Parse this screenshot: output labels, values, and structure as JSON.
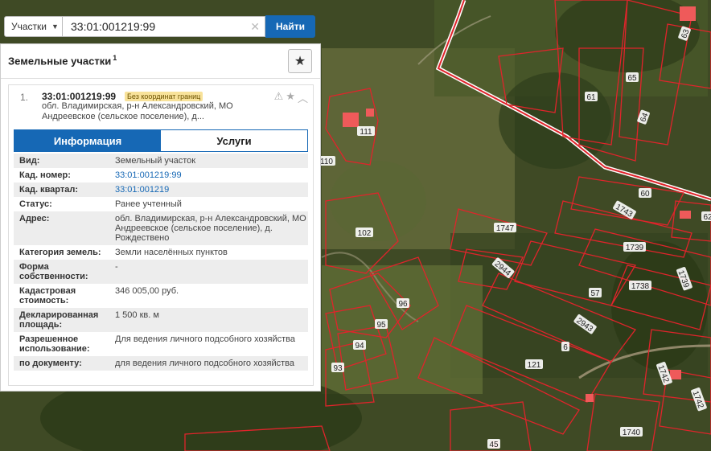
{
  "search": {
    "category": "Участки",
    "value": "33:01:001219:99",
    "find_label": "Найти"
  },
  "panel": {
    "title": "Земельные участки",
    "title_count": "1"
  },
  "result": {
    "index": "1.",
    "cad_number": "33:01:001219:99",
    "badge": "Без координат границ",
    "address": "обл. Владимирская, р-н Александровский, МО Андреевское (сельское поселение), д..."
  },
  "tabs": [
    {
      "label": "Информация"
    },
    {
      "label": "Услуги"
    }
  ],
  "info_rows": [
    {
      "key": "Вид:",
      "value": "Земельный участок"
    },
    {
      "key": "Кад. номер:",
      "value": "33:01:001219:99"
    },
    {
      "key": "Кад. квартал:",
      "value": "33:01:001219"
    },
    {
      "key": "Статус:",
      "value": "Ранее учтенный"
    },
    {
      "key": "Адрес:",
      "value": "обл. Владимирская, р-н Александровский, МО Андреевское (сельское поселение), д. Рождествено"
    },
    {
      "key": "Категория земель:",
      "value": "Земли населённых пунктов"
    },
    {
      "key": "Форма собственности:",
      "value": "-"
    },
    {
      "key": "Кадастровая стоимость:",
      "value": "346 005,00 руб."
    },
    {
      "key": "Декларированная площадь:",
      "value": "1 500 кв. м"
    },
    {
      "key": "Разрешенное использование:",
      "value": "Для ведения личного подсобного хозяйства"
    },
    {
      "key": "по документу:",
      "value": "для ведения личного подсобного хозяйства"
    }
  ],
  "map_labels": [
    "63",
    "65",
    "61",
    "64",
    "111",
    "110",
    "60",
    "1743",
    "1747",
    "102",
    "1739",
    "2944",
    "1738",
    "1739",
    "57",
    "96",
    "95",
    "2943",
    "94",
    "6",
    "93",
    "121",
    "1742",
    "1742",
    "1740",
    "45",
    "62"
  ],
  "colors": {
    "accent": "#1668b5",
    "parcel_border": "#e0242b",
    "badge_bg": "#f8e29a"
  },
  "icons": [
    "caret-down-icon",
    "clear-icon",
    "star-icon",
    "warning-icon",
    "star-outline-icon",
    "chevron-up-icon"
  ]
}
